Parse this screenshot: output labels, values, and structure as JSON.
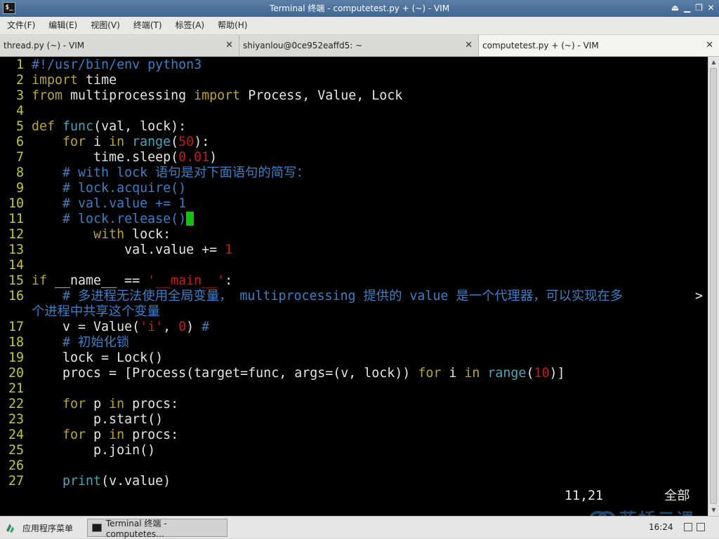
{
  "window": {
    "title": "Terminal 终端 - computetest.py + (~) - VIM",
    "app_icon_glyph": "$_"
  },
  "menu": [
    "文件(F)",
    "编辑(E)",
    "视图(V)",
    "终端(T)",
    "标签(A)",
    "帮助(H)"
  ],
  "tabs": [
    {
      "label": "thread.py (~) - VIM",
      "active": false
    },
    {
      "label": "shiyanlou@0ce952eaffd5: ~",
      "active": false
    },
    {
      "label": "computetest.py + (~) - VIM",
      "active": true
    }
  ],
  "tab_close_glyph": "✕",
  "editor": {
    "lines": [
      {
        "n": "1",
        "t": [
          [
            "cm",
            "#!/usr/bin/env python3"
          ]
        ]
      },
      {
        "n": "2",
        "t": [
          [
            "kw",
            "import"
          ],
          [
            "",
            " time"
          ]
        ]
      },
      {
        "n": "3",
        "t": [
          [
            "kw",
            "from"
          ],
          [
            "",
            " multiprocessing "
          ],
          [
            "kw",
            "import"
          ],
          [
            "",
            " Process, Value, Lock"
          ]
        ]
      },
      {
        "n": "4",
        "t": []
      },
      {
        "n": "5",
        "t": [
          [
            "kw",
            "def"
          ],
          [
            "",
            " "
          ],
          [
            "fn",
            "func"
          ],
          [
            "",
            "(val, lock):"
          ]
        ]
      },
      {
        "n": "6",
        "t": [
          [
            "",
            "    "
          ],
          [
            "kw",
            "for"
          ],
          [
            "",
            " i "
          ],
          [
            "kw",
            "in"
          ],
          [
            "",
            " "
          ],
          [
            "fn",
            "range"
          ],
          [
            "",
            "("
          ],
          [
            "num",
            "50"
          ],
          [
            "",
            "):"
          ]
        ]
      },
      {
        "n": "7",
        "t": [
          [
            "",
            "        time.sleep("
          ],
          [
            "num",
            "0.01"
          ],
          [
            "",
            ")"
          ]
        ]
      },
      {
        "n": "8",
        "t": [
          [
            "",
            "    "
          ],
          [
            "cm",
            "# with lock 语句是对下面语句的简写："
          ]
        ]
      },
      {
        "n": "9",
        "t": [
          [
            "",
            "    "
          ],
          [
            "cm",
            "# lock.acquire()"
          ]
        ]
      },
      {
        "n": "10",
        "t": [
          [
            "",
            "    "
          ],
          [
            "cm",
            "# val.value += 1"
          ]
        ]
      },
      {
        "n": "11",
        "t": [
          [
            "",
            "    "
          ],
          [
            "cm",
            "# lock.release()"
          ],
          [
            "cursor",
            ""
          ]
        ]
      },
      {
        "n": "12",
        "t": [
          [
            "",
            "        "
          ],
          [
            "kw",
            "with"
          ],
          [
            "",
            " lock:"
          ]
        ]
      },
      {
        "n": "13",
        "t": [
          [
            "",
            "            val.value += "
          ],
          [
            "num",
            "1"
          ]
        ]
      },
      {
        "n": "14",
        "t": []
      },
      {
        "n": "15",
        "t": [
          [
            "kw",
            "if"
          ],
          [
            "",
            " __name__ == "
          ],
          [
            "str",
            "'__main__'"
          ],
          [
            "",
            ":"
          ]
        ]
      },
      {
        "n": "16",
        "t": [
          [
            "",
            "    "
          ],
          [
            "cm",
            "# 多进程无法使用全局变量， multiprocessing 提供的 value 是一个代理器，可以实现在多"
          ]
        ]
      },
      {
        "n": "",
        "t": [
          [
            "cm",
            "个进程中共享这个变量"
          ]
        ]
      },
      {
        "n": "17",
        "t": [
          [
            "",
            "    v = Value("
          ],
          [
            "str",
            "'i'"
          ],
          [
            "",
            ", "
          ],
          [
            "num",
            "0"
          ],
          [
            "",
            ") "
          ],
          [
            "cm",
            "#"
          ]
        ]
      },
      {
        "n": "18",
        "t": [
          [
            "",
            "    "
          ],
          [
            "cm",
            "# 初始化锁"
          ]
        ]
      },
      {
        "n": "19",
        "t": [
          [
            "",
            "    lock = Lock()"
          ]
        ]
      },
      {
        "n": "20",
        "t": [
          [
            "",
            "    procs = [Process(target=func, args=(v, lock)) "
          ],
          [
            "kw",
            "for"
          ],
          [
            "",
            " i "
          ],
          [
            "kw",
            "in"
          ],
          [
            "",
            " "
          ],
          [
            "fn",
            "range"
          ],
          [
            "",
            "("
          ],
          [
            "num",
            "10"
          ],
          [
            "",
            ")]"
          ]
        ]
      },
      {
        "n": "21",
        "t": []
      },
      {
        "n": "22",
        "t": [
          [
            "",
            "    "
          ],
          [
            "kw",
            "for"
          ],
          [
            "",
            " p "
          ],
          [
            "kw",
            "in"
          ],
          [
            "",
            " procs:"
          ]
        ]
      },
      {
        "n": "23",
        "t": [
          [
            "",
            "        p.start()"
          ]
        ]
      },
      {
        "n": "24",
        "t": [
          [
            "",
            "    "
          ],
          [
            "kw",
            "for"
          ],
          [
            "",
            " p "
          ],
          [
            "kw",
            "in"
          ],
          [
            "",
            " procs:"
          ]
        ]
      },
      {
        "n": "25",
        "t": [
          [
            "",
            "        p.join()"
          ]
        ]
      },
      {
        "n": "26",
        "t": []
      },
      {
        "n": "27",
        "t": [
          [
            "",
            "    "
          ],
          [
            "fn",
            "print"
          ],
          [
            "",
            "(v.value)"
          ]
        ]
      }
    ],
    "wrap_marker": ">",
    "cursor_position": "11,21",
    "scroll_status": "全部"
  },
  "taskbar": {
    "start_label": "应用程序菜单",
    "task_label": "Terminal 终端 - computetes…",
    "clock": "16:24",
    "watermark": "蓝桥云课"
  },
  "colors": {
    "line_number": "#c9c92b",
    "keyword": "#b8a636",
    "builtin": "#4aa6b8",
    "number_string": "#c41a1a",
    "comment": "#3d7fc4",
    "cursor": "#11c211"
  }
}
